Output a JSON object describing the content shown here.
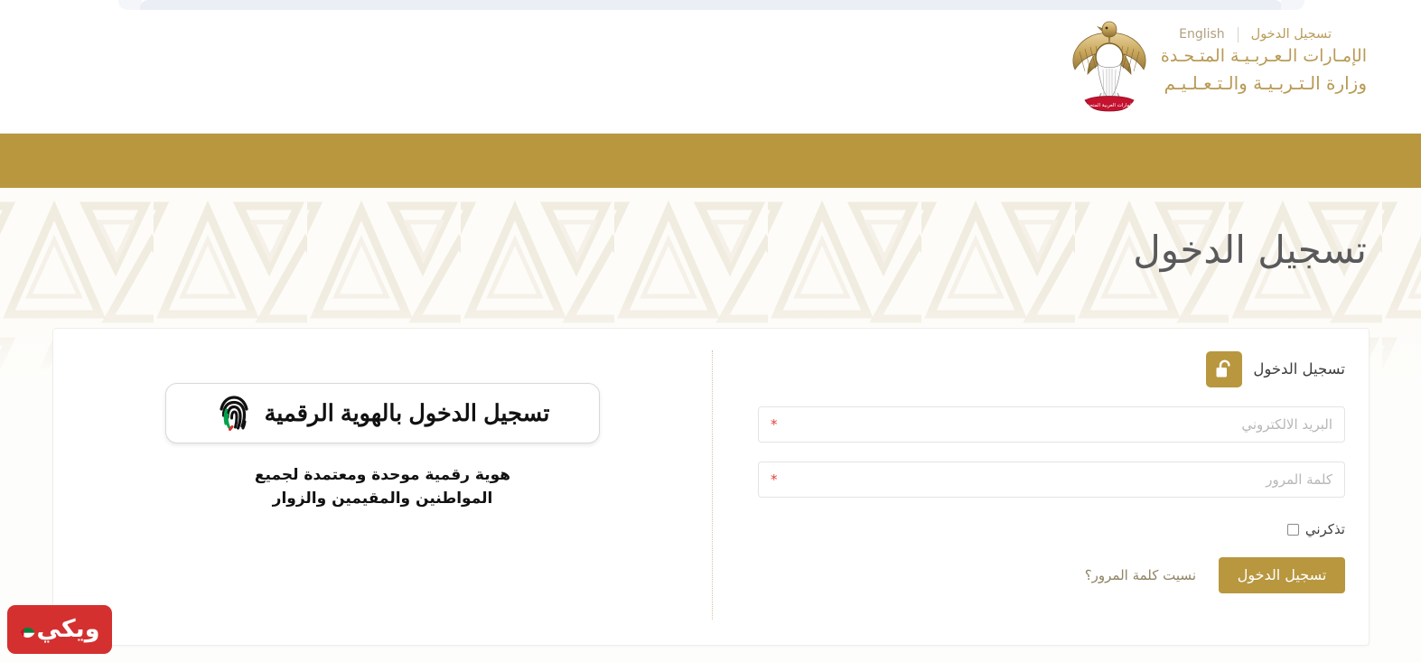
{
  "browser": {
    "tab_present": true
  },
  "header": {
    "nav": {
      "login_label": "تسجيل الدخول",
      "language_label": "English"
    },
    "brand": {
      "emblem_name": "uae-falcon-emblem",
      "line1": "الإمـارات الـعـربـيـة المتـحـدة",
      "line2": "وزارة الـتـربـيـة والـتـعـلـيـم"
    }
  },
  "hero": {
    "page_title": "تسجيل الدخول"
  },
  "card": {
    "credentials": {
      "lock_icon": "unlock-icon",
      "heading": "تسجيل الدخول",
      "email": {
        "placeholder": "البريد الالكتروني",
        "value": "",
        "required_mark": "*"
      },
      "password": {
        "placeholder": "كلمة المرور",
        "value": "",
        "required_mark": "*"
      },
      "remember_label": "تذكرني",
      "remember_checked": false,
      "submit_label": "تسجيل الدخول",
      "forgot_label": "نسيت كلمة المرور؟"
    },
    "digital_identity": {
      "icon": "fingerprint-icon",
      "button_label": "تسجيل الدخول بالهوية الرقمية",
      "subtitle": "هوية رقمية موحدة ومعتمدة لجميع المواطنين والمقيمين والزوار"
    }
  },
  "watermark": {
    "text": "ويكي",
    "flag_icon": "uae-flag-circle-icon"
  },
  "colors": {
    "gold": "#b8973f",
    "gold_text": "#b99c5c",
    "title_gray": "#59595b",
    "required_red": "#e2403a",
    "watermark_red": "#d4302f",
    "page_bg": "#fdfdfb"
  }
}
